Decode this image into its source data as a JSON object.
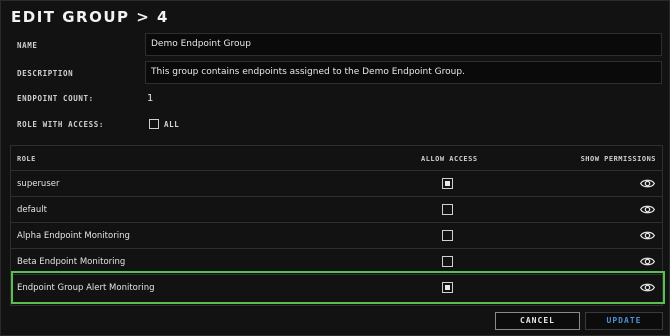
{
  "dialog": {
    "title": "EDIT GROUP > 4"
  },
  "form": {
    "name_label": "NAME",
    "name_value": "Demo Endpoint Group",
    "description_label": "DESCRIPTION",
    "description_value": "This group contains endpoints assigned to the Demo Endpoint Group.",
    "endpoint_count_label": "ENDPOINT COUNT:",
    "endpoint_count_value": "1",
    "role_access_label": "ROLE WITH ACCESS:",
    "all_label": "ALL",
    "all_checked": false
  },
  "table": {
    "headers": {
      "role": "ROLE",
      "allow_access": "ALLOW ACCESS",
      "show_permissions": "SHOW PERMISSIONS"
    },
    "rows": [
      {
        "role": "superuser",
        "allow_access": true
      },
      {
        "role": "default",
        "allow_access": false
      },
      {
        "role": "Alpha Endpoint Monitoring",
        "allow_access": false
      },
      {
        "role": "Beta Endpoint Monitoring",
        "allow_access": false
      },
      {
        "role": "Endpoint Group Alert Monitoring",
        "allow_access": true
      }
    ],
    "highlighted_row": 4,
    "show_permissions_icon": "eye-icon"
  },
  "buttons": {
    "cancel_label": "CANCEL",
    "update_label": "UPDATE"
  },
  "colors": {
    "highlight": "#57c04e",
    "update_text": "#4f8fd6",
    "background": "#121212"
  }
}
